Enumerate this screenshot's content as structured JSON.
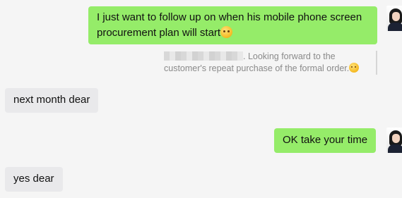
{
  "messages": [
    {
      "id": "m1",
      "side": "outgoing",
      "text": "I just want to follow up on when his mobile phone screen procurement plan will start",
      "emoji": "thinking-face-emoji"
    },
    {
      "id": "q1",
      "type": "quote",
      "text": ". Looking forward to the customer's repeat purchase of the formal order.",
      "emoji": "monocle-face-emoji"
    },
    {
      "id": "m2",
      "side": "incoming",
      "text": "next month dear"
    },
    {
      "id": "m3",
      "side": "outgoing",
      "text": "OK take your time"
    },
    {
      "id": "m4",
      "side": "incoming",
      "text": "yes dear"
    }
  ],
  "colors": {
    "outgoing_bubble": "#95ec69",
    "incoming_bubble": "#e9e9eb",
    "background": "#f5f5f5"
  }
}
